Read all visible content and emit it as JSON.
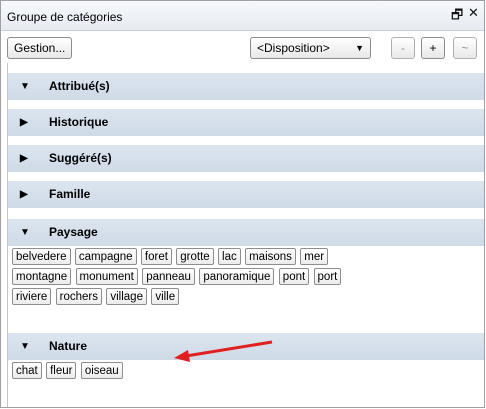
{
  "window": {
    "title": "Groupe de catégories",
    "float_icon": "float-icon",
    "close_icon": "close-icon"
  },
  "toolbar": {
    "gestion_label": "Gestion...",
    "disposition_value": "<Disposition>",
    "minus_label": "-",
    "plus_label": "+",
    "tilde_label": "~"
  },
  "groups": [
    {
      "label": "Attribué(s)",
      "expanded": true,
      "tags": []
    },
    {
      "label": "Historique",
      "expanded": false,
      "tags": []
    },
    {
      "label": "Suggéré(s)",
      "expanded": false,
      "tags": []
    },
    {
      "label": "Famille",
      "expanded": false,
      "tags": []
    },
    {
      "label": "Paysage",
      "expanded": true,
      "tags": [
        "belvedere",
        "campagne",
        "foret",
        "grotte",
        "lac",
        "maisons",
        "mer",
        "montagne",
        "monument",
        "panneau",
        "panoramique",
        "pont",
        "port",
        "riviere",
        "rochers",
        "village",
        "ville"
      ]
    },
    {
      "label": "Nature",
      "expanded": true,
      "tags": [
        "chat",
        "fleur",
        "oiseau"
      ]
    }
  ],
  "annotation": {
    "color": "#e02020"
  }
}
